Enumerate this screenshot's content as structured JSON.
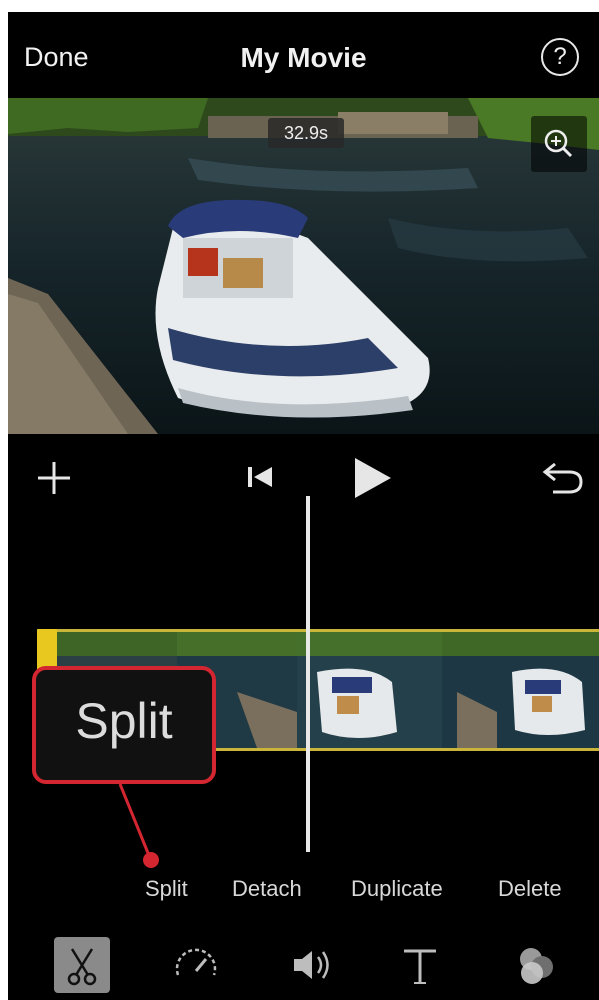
{
  "header": {
    "done_label": "Done",
    "title": "My Movie",
    "help_label": "?"
  },
  "viewer": {
    "duration_badge": "32.9s"
  },
  "callout": {
    "text": "Split",
    "border_color": "#d32630"
  },
  "actions": [
    "Split",
    "Detach",
    "Duplicate",
    "Delete"
  ],
  "toolbar": {
    "tools": [
      "scissors-icon",
      "speed-icon",
      "volume-icon",
      "text-icon",
      "filter-icon"
    ],
    "selected": "scissors-icon"
  },
  "colors": {
    "background": "#000000",
    "clip_border": "#c9b53a",
    "clip_handle": "#e8c81e",
    "callout": "#d32630"
  }
}
